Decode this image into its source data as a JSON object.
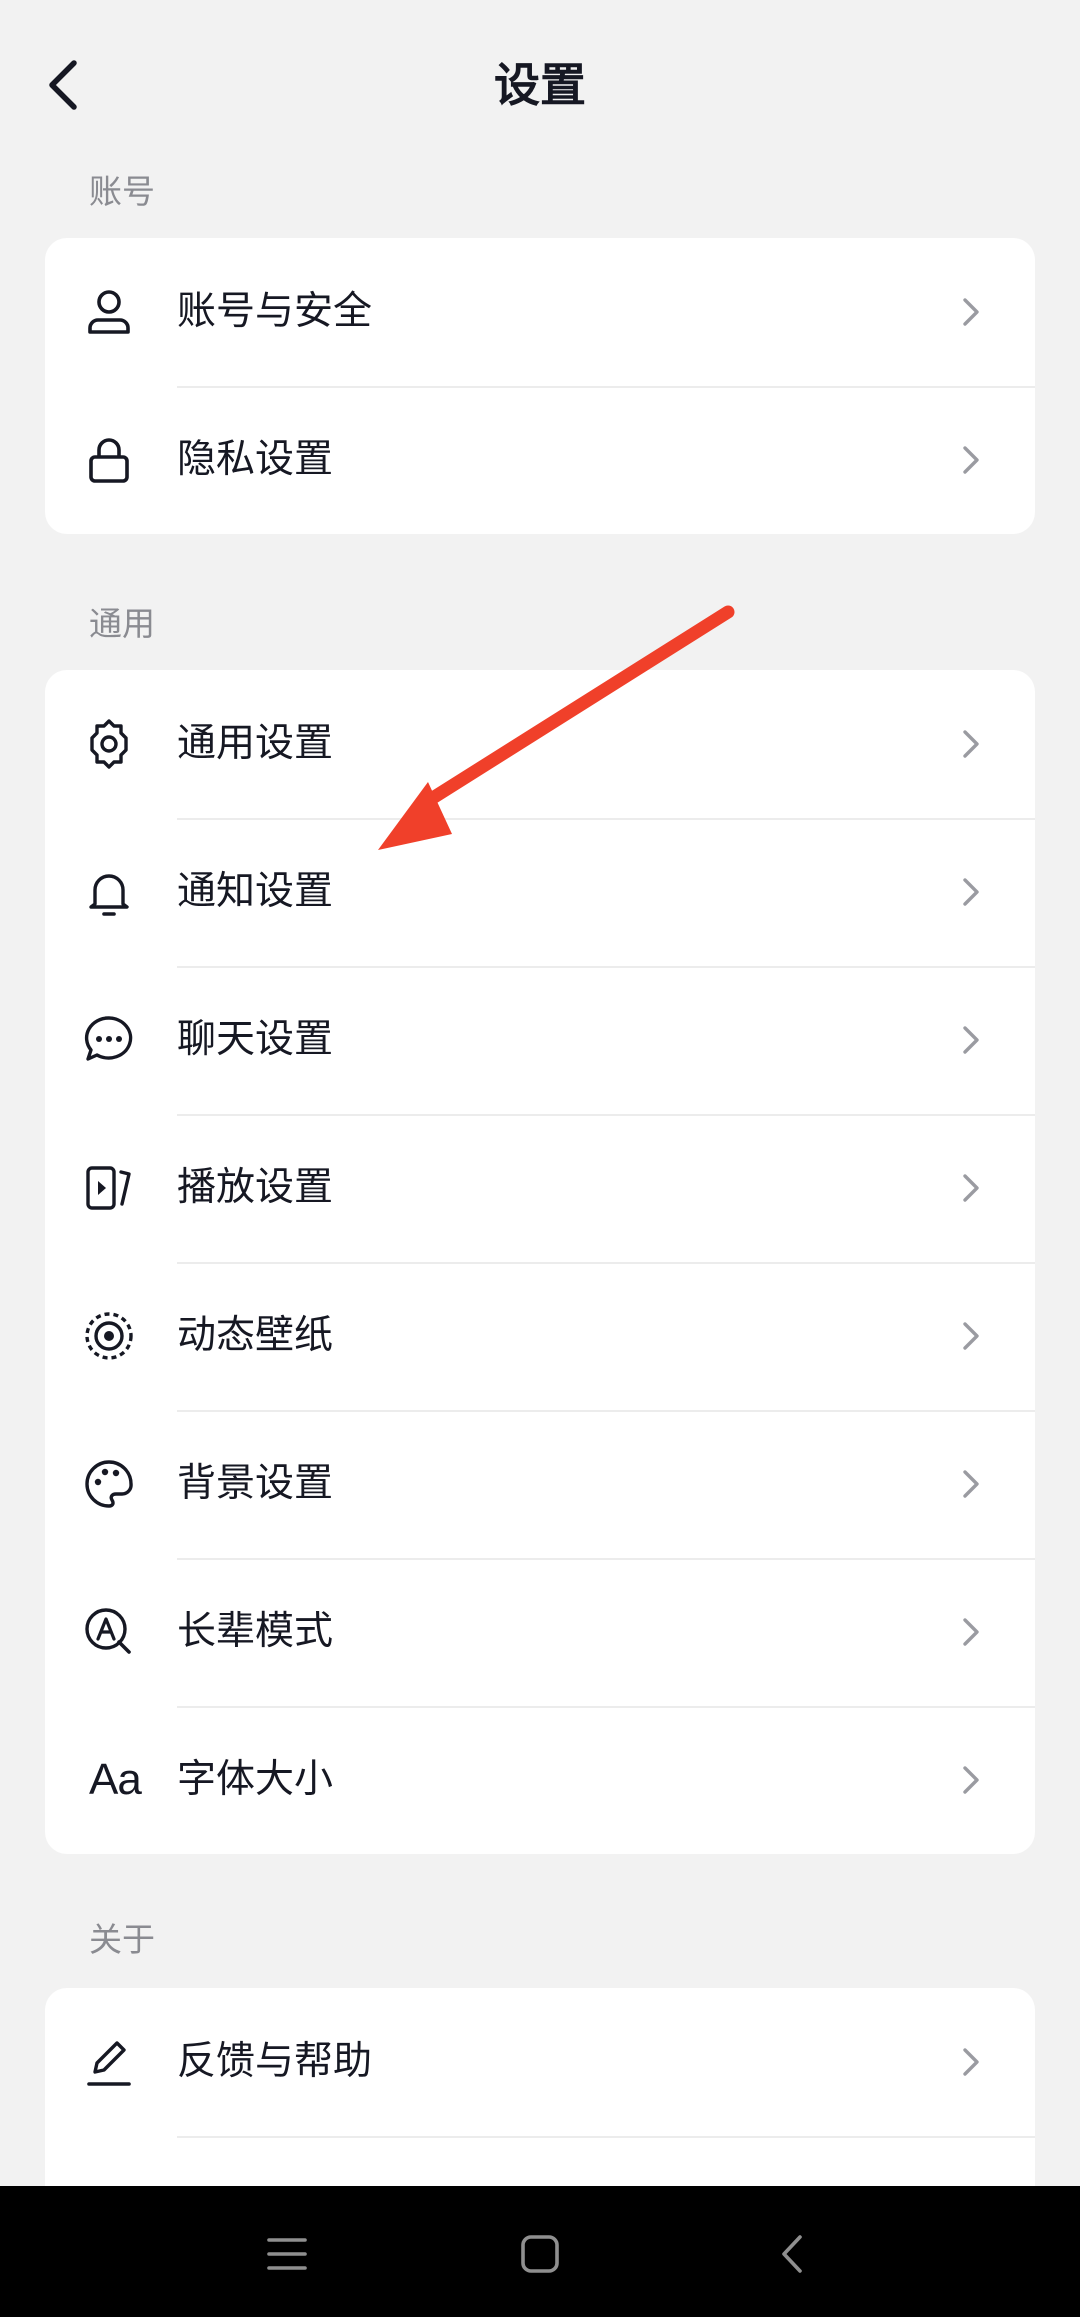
{
  "header": {
    "title": "设置",
    "back_icon": "chevron-left-icon"
  },
  "sections": [
    {
      "label": "账号",
      "items": [
        {
          "label": "账号与安全",
          "icon": "user-icon"
        },
        {
          "label": "隐私设置",
          "icon": "lock-icon"
        }
      ]
    },
    {
      "label": "通用",
      "items": [
        {
          "label": "通用设置",
          "icon": "gear-icon"
        },
        {
          "label": "通知设置",
          "icon": "bell-icon"
        },
        {
          "label": "聊天设置",
          "icon": "chat-bubble-icon"
        },
        {
          "label": "播放设置",
          "icon": "play-icon"
        },
        {
          "label": "动态壁纸",
          "icon": "target-icon"
        },
        {
          "label": "背景设置",
          "icon": "palette-icon"
        },
        {
          "label": "长辈模式",
          "icon": "magnifier-a-icon"
        },
        {
          "label": "字体大小",
          "icon": "font-size-icon",
          "icon_text": "Aa"
        }
      ]
    },
    {
      "label": "关于",
      "items": [
        {
          "label": "反馈与帮助",
          "icon": "pencil-icon"
        }
      ]
    }
  ],
  "navbar": {
    "items": [
      "menu-icon",
      "home-icon",
      "back-icon"
    ]
  },
  "colors": {
    "background": "#f2f2f2",
    "card": "#ffffff",
    "text": "#161823",
    "muted": "#8a8b91",
    "annotation_arrow": "#f0402a"
  }
}
